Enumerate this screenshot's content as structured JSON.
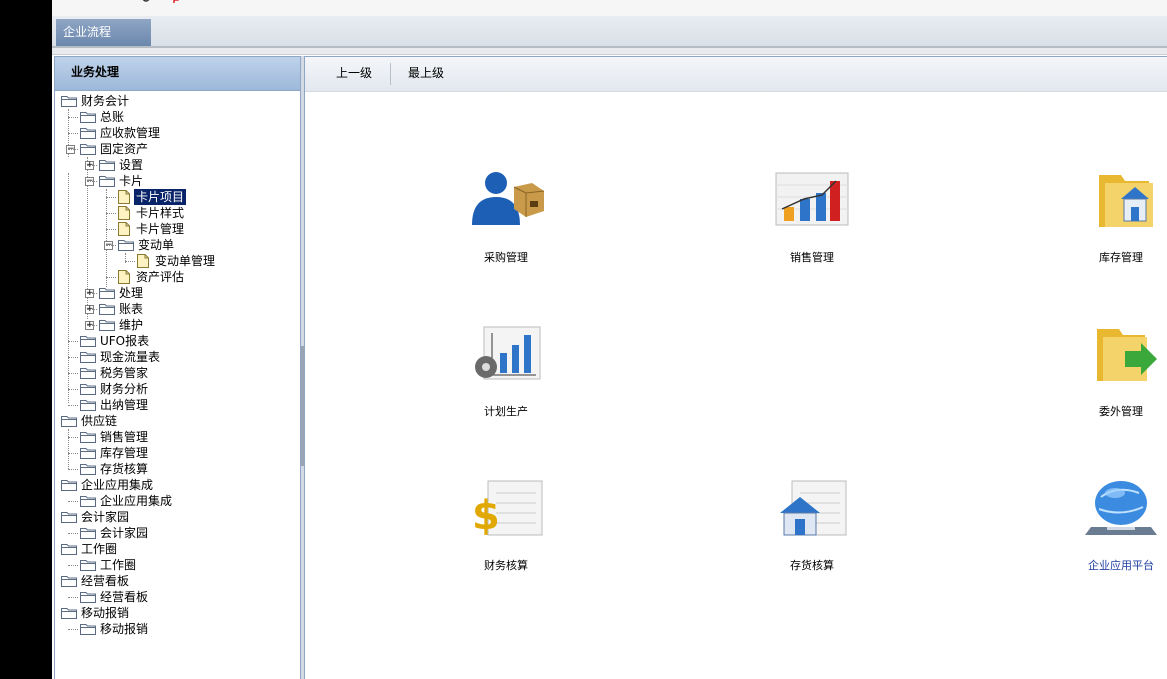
{
  "tab": {
    "label": "企业流程"
  },
  "left_panel": {
    "title": "业务处理",
    "tree": [
      {
        "label": "财务会计",
        "kind": "folder",
        "depth": 0,
        "toggle": "open"
      },
      {
        "label": "总账",
        "kind": "folder",
        "depth": 1
      },
      {
        "label": "应收款管理",
        "kind": "folder",
        "depth": 1
      },
      {
        "label": "固定资产",
        "kind": "folder",
        "depth": 1,
        "toggle": "minus"
      },
      {
        "label": "设置",
        "kind": "folder",
        "depth": 2,
        "toggle": "plus"
      },
      {
        "label": "卡片",
        "kind": "folder",
        "depth": 2,
        "toggle": "minus"
      },
      {
        "label": "卡片项目",
        "kind": "doc",
        "depth": 3,
        "selected": true
      },
      {
        "label": "卡片样式",
        "kind": "doc",
        "depth": 3
      },
      {
        "label": "卡片管理",
        "kind": "doc",
        "depth": 3
      },
      {
        "label": "变动单",
        "kind": "folder",
        "depth": 3,
        "toggle": "minus"
      },
      {
        "label": "变动单管理",
        "kind": "doc",
        "depth": 4
      },
      {
        "label": "资产评估",
        "kind": "doc",
        "depth": 3
      },
      {
        "label": "处理",
        "kind": "folder",
        "depth": 2,
        "toggle": "plus"
      },
      {
        "label": "账表",
        "kind": "folder",
        "depth": 2,
        "toggle": "plus"
      },
      {
        "label": "维护",
        "kind": "folder",
        "depth": 2,
        "toggle": "plus"
      },
      {
        "label": "UFO报表",
        "kind": "folder",
        "depth": 1
      },
      {
        "label": "现金流量表",
        "kind": "folder",
        "depth": 1
      },
      {
        "label": "税务管家",
        "kind": "folder",
        "depth": 1
      },
      {
        "label": "财务分析",
        "kind": "folder",
        "depth": 1
      },
      {
        "label": "出纳管理",
        "kind": "folder",
        "depth": 1
      },
      {
        "label": "供应链",
        "kind": "folder",
        "depth": 0
      },
      {
        "label": "销售管理",
        "kind": "folder",
        "depth": 1
      },
      {
        "label": "库存管理",
        "kind": "folder",
        "depth": 1
      },
      {
        "label": "存货核算",
        "kind": "folder",
        "depth": 1
      },
      {
        "label": "企业应用集成",
        "kind": "folder",
        "depth": 0
      },
      {
        "label": "企业应用集成",
        "kind": "folder",
        "depth": 1
      },
      {
        "label": "会计家园",
        "kind": "folder",
        "depth": 0
      },
      {
        "label": "会计家园",
        "kind": "folder",
        "depth": 1
      },
      {
        "label": "工作圈",
        "kind": "folder",
        "depth": 0
      },
      {
        "label": "工作圈",
        "kind": "folder",
        "depth": 1
      },
      {
        "label": "经营看板",
        "kind": "folder",
        "depth": 0
      },
      {
        "label": "经营看板",
        "kind": "folder",
        "depth": 1
      },
      {
        "label": "移动报销",
        "kind": "folder",
        "depth": 0
      },
      {
        "label": "移动报销",
        "kind": "folder",
        "depth": 1
      }
    ]
  },
  "toolbar": {
    "up_label": "上一级",
    "top_label": "最上级"
  },
  "modules": [
    {
      "label": "采购管理",
      "icon": "purchase-icon"
    },
    {
      "label": "销售管理",
      "icon": "sales-chart-icon"
    },
    {
      "label": "库存管理",
      "icon": "inventory-folder-icon"
    },
    {
      "label": "计划生产",
      "icon": "production-plan-icon"
    },
    {
      "label": "委外管理",
      "icon": "outsourcing-icon"
    },
    {
      "label": "财务核算",
      "icon": "finance-dollar-icon"
    },
    {
      "label": "存货核算",
      "icon": "stock-house-icon"
    },
    {
      "label": "企业应用平台",
      "icon": "platform-globe-icon"
    }
  ]
}
